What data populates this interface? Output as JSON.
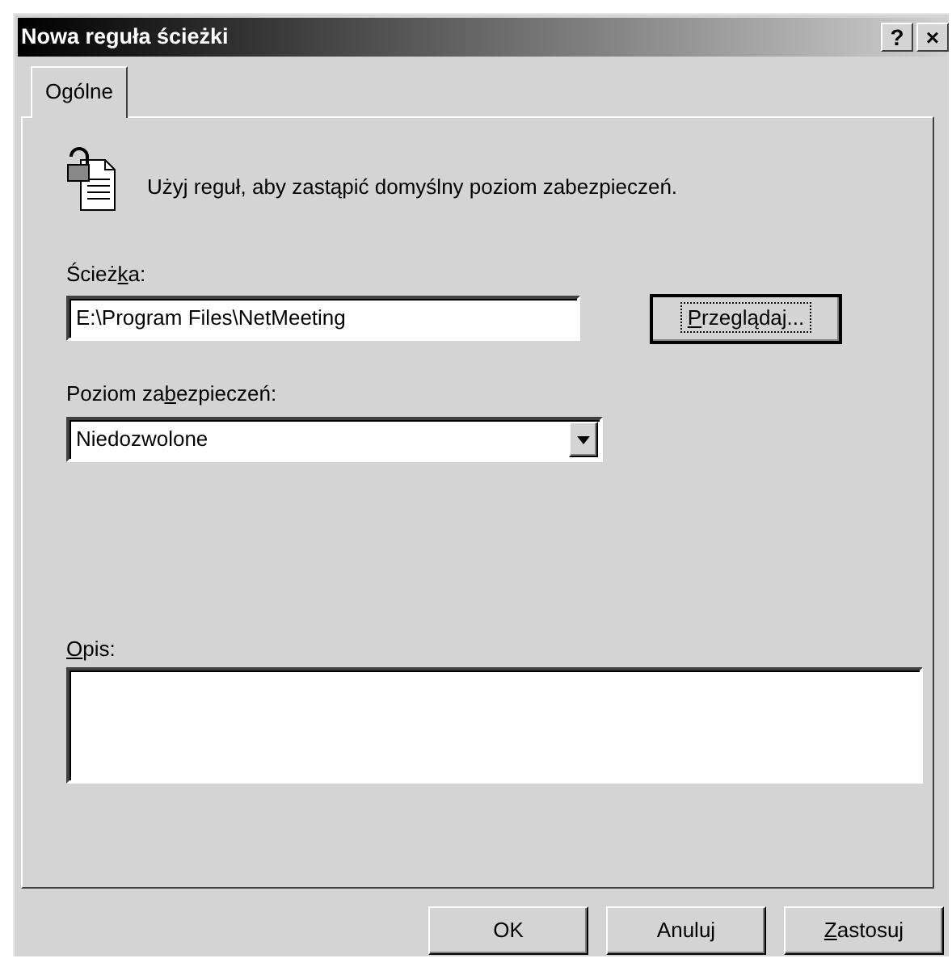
{
  "window": {
    "title": "Nowa reguła ścieżki",
    "title_buttons": [
      "?",
      "×"
    ]
  },
  "tabs": [
    {
      "label": "Ogólne",
      "selected": true
    }
  ],
  "intro": {
    "text": "Użyj reguł, aby zastąpić domyślny poziom zabezpieczeń."
  },
  "path": {
    "label": {
      "before": "Ścież",
      "access_key": "k",
      "after": "a:"
    },
    "value": "E:\\Program Files\\NetMeeting"
  },
  "browse_button": {
    "label": {
      "access_key": "P",
      "after": "rzeglądaj..."
    },
    "focused": true
  },
  "security_level": {
    "label": {
      "before": "Poziom za",
      "access_key": "b",
      "after": "ezpieczeń:"
    },
    "value": "Niedozwolone"
  },
  "description": {
    "label": {
      "access_key": "O",
      "after": "pis:"
    }
  },
  "buttons": [
    {
      "label": {
        "before": "OK"
      }
    },
    {
      "label": {
        "before": "Anuluj"
      }
    },
    {
      "label": {
        "access_key": "Z",
        "after": "astosuj"
      }
    }
  ]
}
